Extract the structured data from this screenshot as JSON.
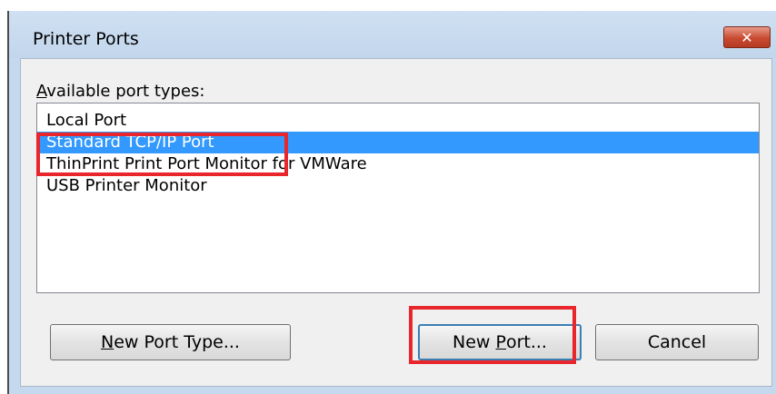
{
  "dialog": {
    "title": "Printer Ports",
    "close_label": "✕"
  },
  "available_ports": {
    "label_accel": "A",
    "label_rest": "vailable port types:",
    "items": [
      {
        "label": "Local Port",
        "selected": false
      },
      {
        "label": "Standard TCP/IP Port",
        "selected": true
      },
      {
        "label": "ThinPrint Print Port Monitor for VMWare",
        "selected": false
      },
      {
        "label": "USB Printer Monitor",
        "selected": false
      }
    ]
  },
  "buttons": {
    "new_port_type": {
      "accel": "N",
      "rest": "ew Port Type..."
    },
    "new_port": {
      "pre": "New ",
      "accel": "P",
      "rest": "ort..."
    },
    "cancel": "Cancel"
  },
  "colors": {
    "selection": "#3399ff",
    "highlight_box": "#e8262b"
  }
}
